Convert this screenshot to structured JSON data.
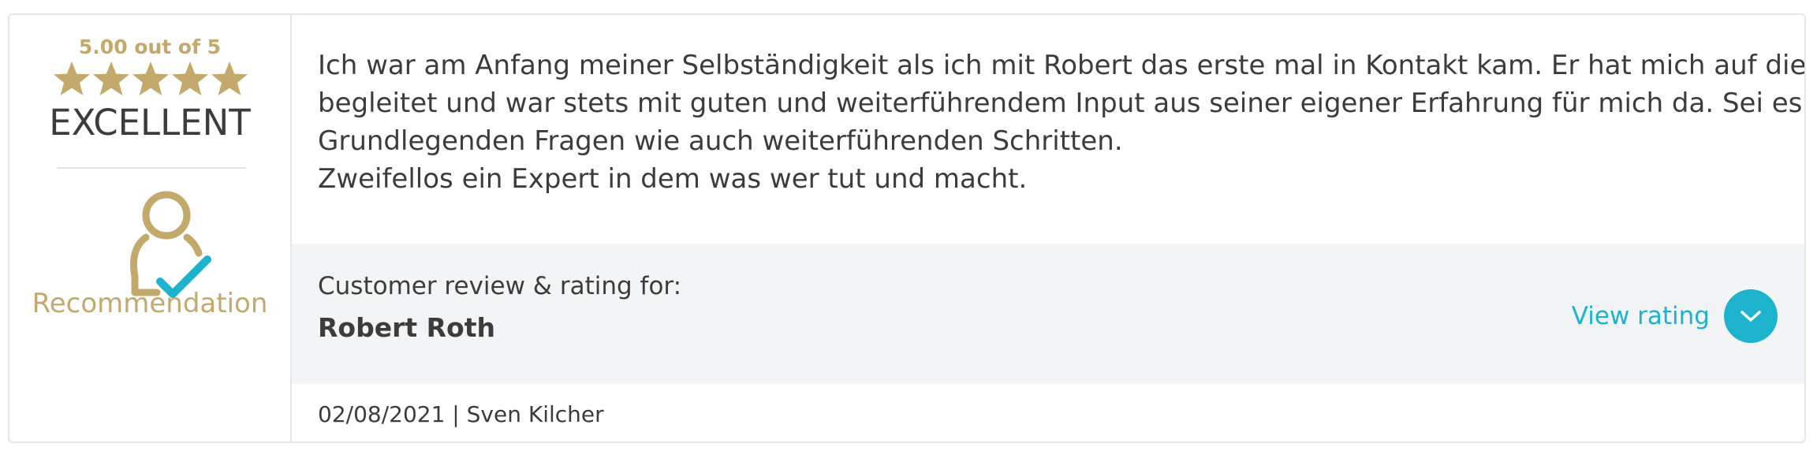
{
  "rating": {
    "score_text": "5.00 out of 5",
    "stars": 5,
    "max_stars": 5,
    "verdict": "EXCELLENT",
    "recommendation_label": "Recommendation"
  },
  "review": {
    "lines": [
      "Ich war am Anfang meiner Selbständigkeit als ich mit Robert das erste mal in Kontakt kam. Er hat mich auf diesem Weg",
      "begleitet und war stets mit guten und weiterführendem Input aus seiner eigener Erfahrung für mich da. Sei es bei",
      "Grundlegenden Fragen wie auch weiterführenden Schritten.",
      "Zweifellos ein Expert in dem was wer tut und macht."
    ]
  },
  "subject": {
    "label": "Customer review & rating for:",
    "name": "Robert Roth"
  },
  "actions": {
    "view_rating_label": "View rating"
  },
  "meta": {
    "date_author": "02/08/2021 | Sven Kilcher"
  },
  "colors": {
    "gold": "#c3a96b",
    "accent": "#1eb3cc",
    "text": "#3c3c3c",
    "band": "#f2f4f5"
  },
  "icons": {
    "star": "star-icon",
    "recommendation": "user-check-icon",
    "expand": "chevron-down-icon"
  }
}
